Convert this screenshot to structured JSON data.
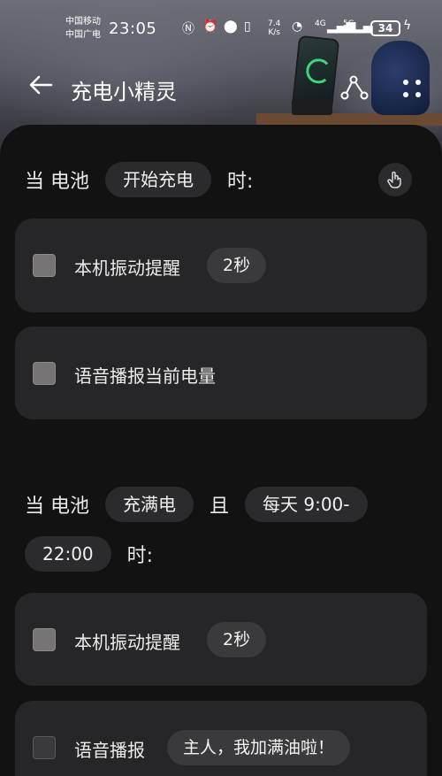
{
  "status_bar": {
    "carrier1": "中国移动",
    "carrier2": "中国广电",
    "time": "23:05",
    "net_speed_value": "7.4",
    "net_speed_unit": "K/s",
    "sig1_label": "4G",
    "sig2_label": "5G",
    "battery_level": "34"
  },
  "app_bar": {
    "title": "充电小精灵"
  },
  "rule1": {
    "prefix": "当 电池",
    "event": "开始充电",
    "suffix": "时:",
    "items": [
      {
        "label": "本机振动提醒",
        "value": "2秒"
      },
      {
        "label": "语音播报当前电量"
      }
    ]
  },
  "rule2": {
    "prefix": "当 电池",
    "event": "充满电",
    "conj": "且",
    "time_range_start": "每天 9:00-",
    "time_range_end": "22:00",
    "suffix": "时:",
    "items": [
      {
        "label": "本机振动提醒",
        "value": "2秒"
      },
      {
        "label": "语音播报",
        "value": "主人，我加满油啦！"
      }
    ]
  },
  "colors": {
    "panel_bg": "#121213",
    "card_bg": "#262628",
    "pill_bg": "#2b2b2d"
  }
}
